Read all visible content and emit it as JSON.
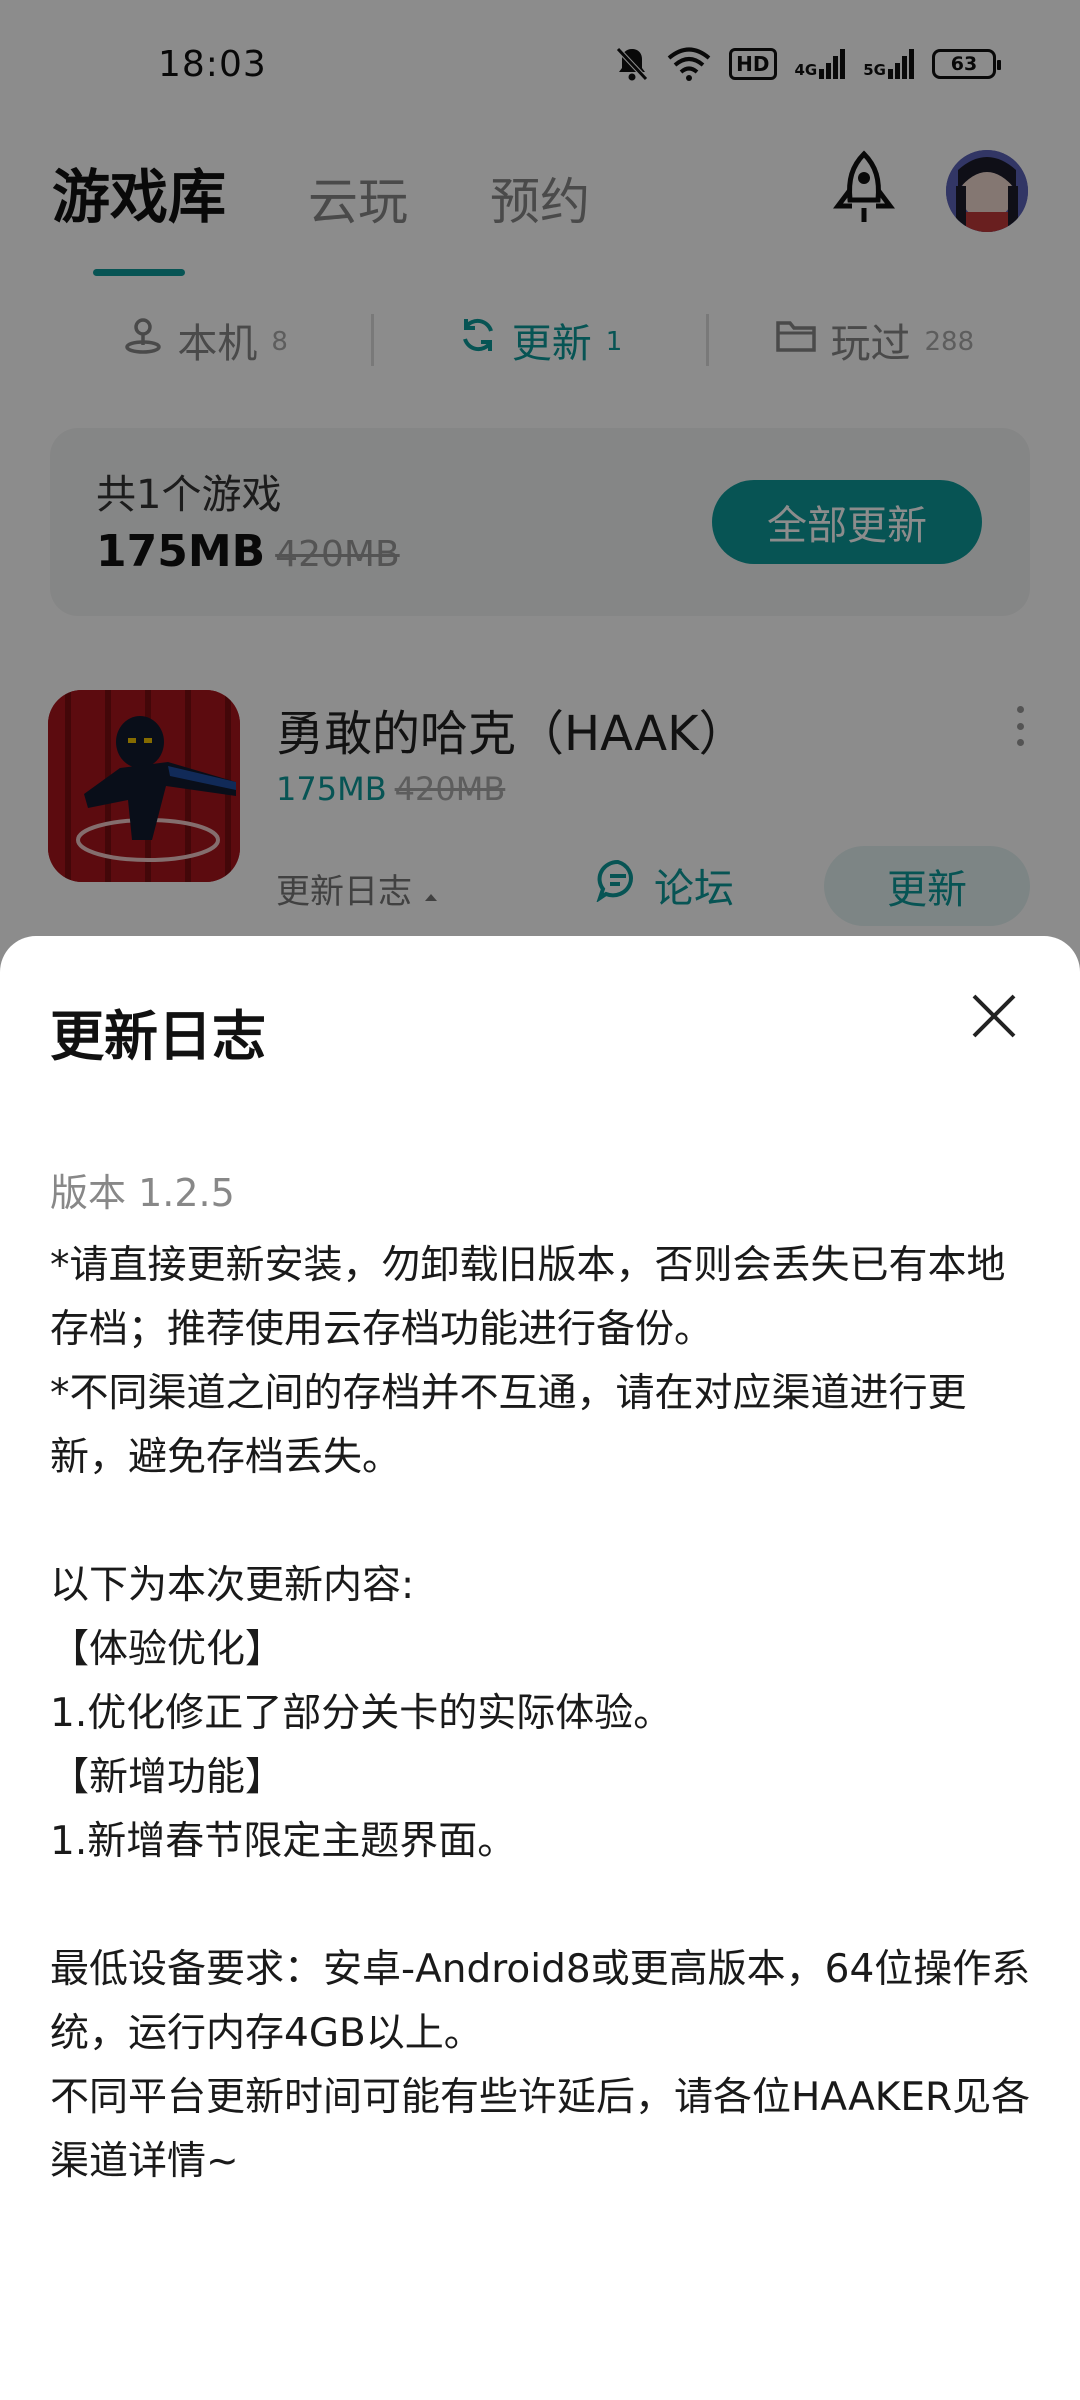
{
  "status_bar": {
    "time": "18:03",
    "icons": [
      "mute-bell-icon",
      "wifi-icon",
      "hd-voice-icon",
      "signal-4g-icon",
      "signal-5g-icon",
      "battery-icon"
    ],
    "hd_label": "HD",
    "net1_label": "4G",
    "net2_label": "5G",
    "battery_level": "63"
  },
  "header": {
    "tabs": [
      {
        "label": "游戏库",
        "active": true
      },
      {
        "label": "云玩",
        "active": false
      },
      {
        "label": "预约",
        "active": false
      }
    ],
    "accent_color": "#0d9a9a"
  },
  "segments": [
    {
      "label": "本机",
      "count": "8",
      "icon": "person-pin-icon"
    },
    {
      "label": "更新",
      "count": "1",
      "icon": "refresh-icon",
      "active": true
    },
    {
      "label": "玩过",
      "count": "288",
      "icon": "folder-icon"
    }
  ],
  "summary": {
    "title": "共1个游戏",
    "size": "175MB",
    "old_size": "420MB",
    "update_all_label": "全部更新"
  },
  "game": {
    "name": "勇敢的哈克（HAAK）",
    "size": "175MB",
    "old_size": "420MB",
    "changelog_label": "更新日志",
    "forum_label": "论坛",
    "update_label": "更新"
  },
  "sheet": {
    "title": "更新日志",
    "version": "版本 1.2.5",
    "lines": [
      "*请直接更新安装，勿卸载旧版本，否则会丢失已有本地存档；推荐使用云存档功能进行备份。",
      "*不同渠道之间的存档并不互通，请在对应渠道进行更新，避免存档丢失。",
      "",
      "以下为本次更新内容:",
      "【体验优化】",
      "1.优化修正了部分关卡的实际体验。",
      "【新增功能】",
      "1.新增春节限定主题界面。",
      "",
      "最低设备要求：安卓-Android8或更高版本，64位操作系统，运行内存4GB以上。",
      "不同平台更新时间可能有些许延后，请各位HAAKER见各渠道详情~"
    ]
  }
}
